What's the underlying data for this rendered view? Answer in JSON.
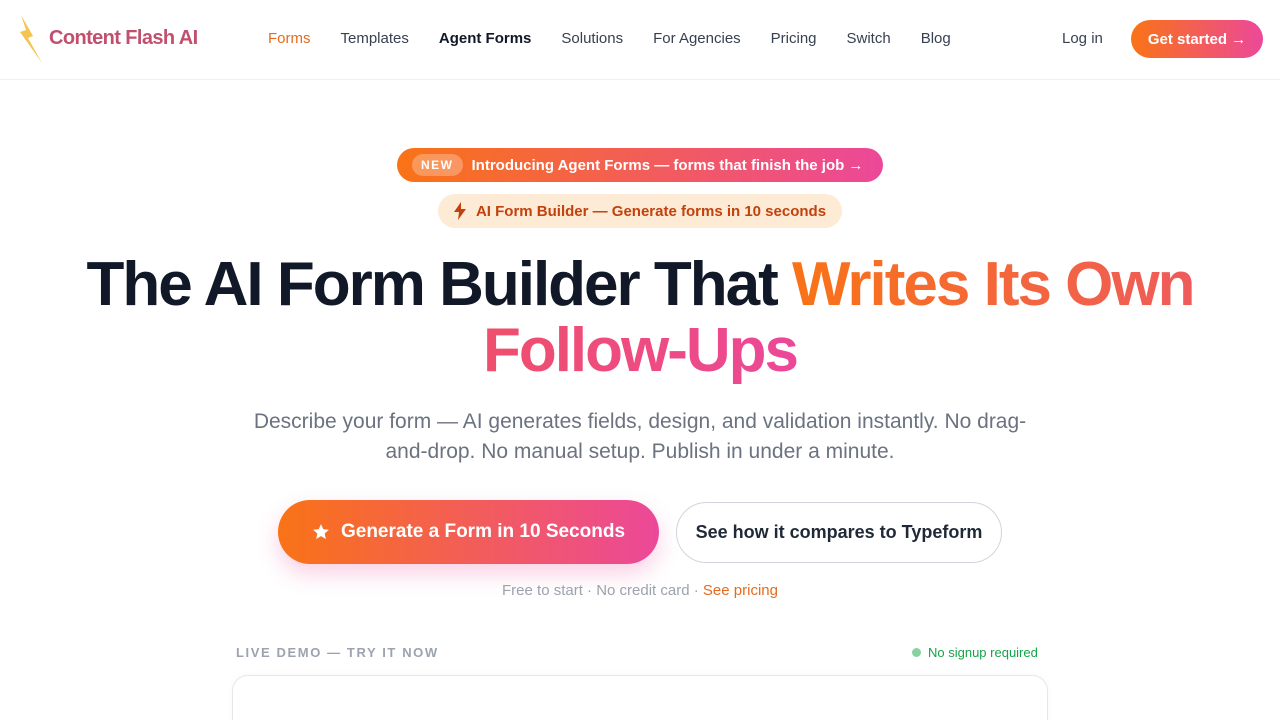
{
  "brand": {
    "name": "Content Flash AI",
    "colors": {
      "accent_orange": "#f97316",
      "accent_pink": "#ec4899",
      "logo_bolt": "#f6c453",
      "logo_text": "#c0506e"
    }
  },
  "nav": {
    "links": [
      {
        "label": "Forms",
        "state": "active"
      },
      {
        "label": "Templates"
      },
      {
        "label": "Agent Forms",
        "state": "bold"
      },
      {
        "label": "Solutions"
      },
      {
        "label": "For Agencies"
      },
      {
        "label": "Pricing"
      },
      {
        "label": "Switch"
      },
      {
        "label": "Blog"
      }
    ],
    "login_label": "Log in",
    "cta_label": "Get started →"
  },
  "announcement": {
    "tag": "NEW",
    "text": "Introducing Agent Forms — forms that finish the job →"
  },
  "badge": {
    "icon": "lightning-icon",
    "text": "AI Form Builder — Generate forms in 10 seconds"
  },
  "hero": {
    "headline_plain": "The AI Form Builder That",
    "headline_accent_1": "Writes Its Own",
    "headline_accent_2": "Follow-Ups",
    "subtitle": "Describe your form — AI generates fields, design, and validation instantly. No drag-and-drop. No manual setup. Publish in under a minute."
  },
  "cta": {
    "primary_icon": "star-icon",
    "primary_label": "Generate a Form in 10 Seconds",
    "secondary_label": "See how it compares to Typeform"
  },
  "fine_print": {
    "text": "Free to start · No credit card ·",
    "link": "See pricing"
  },
  "demo": {
    "label": "LIVE DEMO — TRY IT NOW",
    "status": "No signup required"
  }
}
